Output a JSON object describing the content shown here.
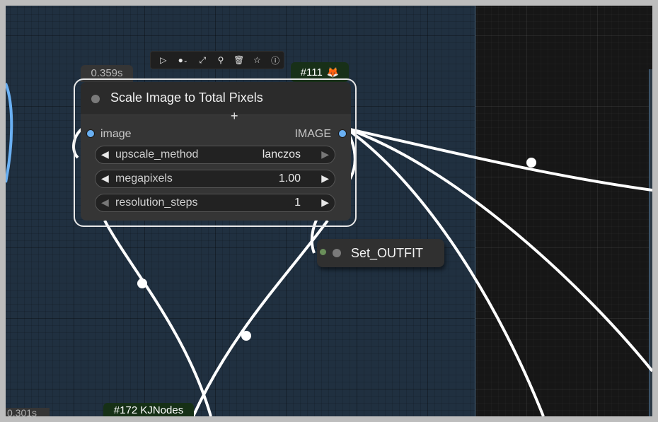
{
  "node": {
    "timing": "0.359s",
    "id_badge": "#111",
    "id_icon": "fox-icon",
    "title": "Scale Image to Total Pixels",
    "input_label": "image",
    "output_label": "IMAGE",
    "input_color": "#6ab0f3",
    "output_color": "#6ab0f3",
    "widgets": [
      {
        "name": "upscale_method",
        "value": "lanczos"
      },
      {
        "name": "megapixels",
        "value": "1.00"
      },
      {
        "name": "resolution_steps",
        "value": "1"
      }
    ]
  },
  "toolbar": {
    "buttons": [
      "play-icon",
      "color-dot-icon",
      "pin-bypass-icon",
      "pin-icon",
      "trash-icon",
      "star-icon",
      "help-icon"
    ]
  },
  "set_node": {
    "title": "Set_OUTFIT"
  },
  "other_badges": {
    "timing": "0.301s",
    "kjnodes": "#172 KJNodes"
  },
  "colors": {
    "canvas": "#181818",
    "group": "#203040",
    "link": "#ffffff",
    "accent_link": "#6ab0f3"
  }
}
